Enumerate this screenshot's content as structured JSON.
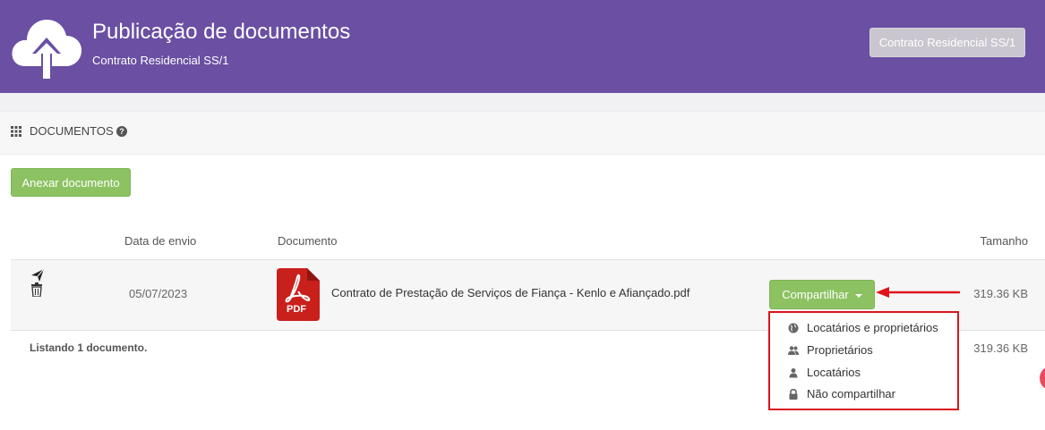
{
  "header": {
    "title": "Publicação de documentos",
    "subtitle": "Contrato Residencial SS/1",
    "contract_button": "Contrato Residencial SS/1"
  },
  "section": {
    "title": "DOCUMENTOS"
  },
  "attach_button": "Anexar documento",
  "table": {
    "headers": {
      "date": "Data de envio",
      "document": "Documento",
      "size": "Tamanho"
    },
    "rows": [
      {
        "date": "05/07/2023",
        "document": "Contrato de Prestação de Serviços de Fiança - Kenlo e Afiançado.pdf",
        "size": "319.36 KB",
        "icon_label": "PDF",
        "share_label": "Compartilhar"
      }
    ],
    "footer": {
      "listing": "Listando 1 documento.",
      "total_size": "319.36 KB"
    }
  },
  "share_menu": {
    "items": [
      {
        "label": "Locatários e proprietários",
        "icon": "globe-icon"
      },
      {
        "label": "Proprietários",
        "icon": "users-icon"
      },
      {
        "label": "Locatários",
        "icon": "user-icon"
      },
      {
        "label": "Não compartilhar",
        "icon": "lock-icon"
      }
    ]
  },
  "colors": {
    "header_bg": "#6a4fa3",
    "button_green": "#8cc261",
    "highlight_red": "#d9151b"
  }
}
